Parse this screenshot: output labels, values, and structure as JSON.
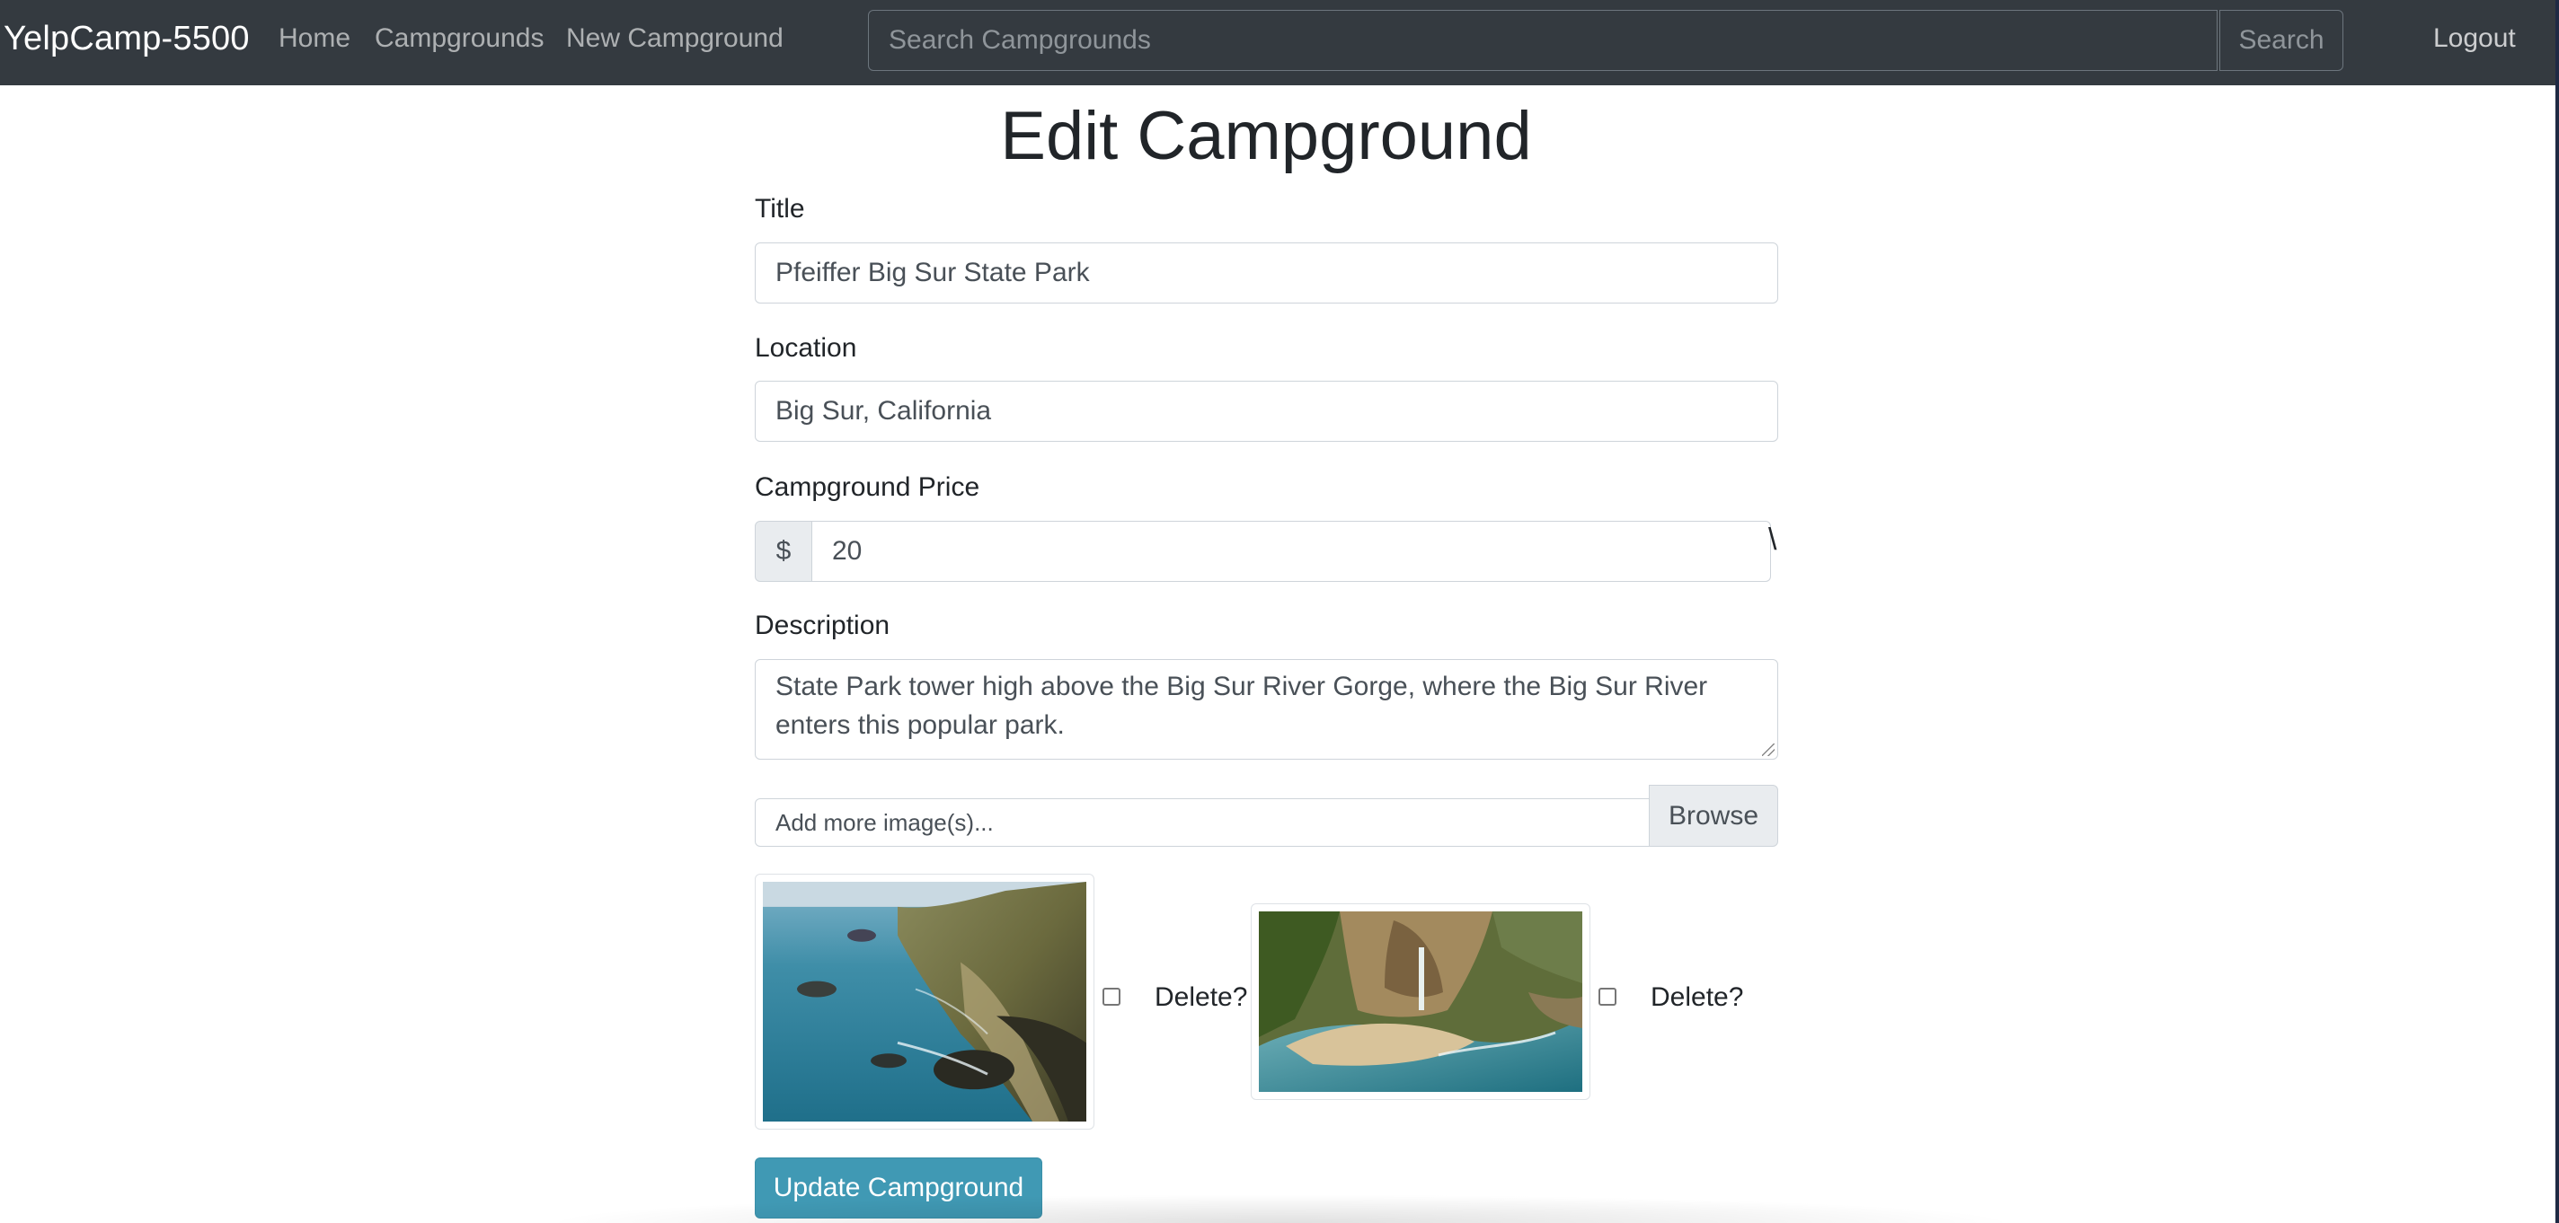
{
  "navbar": {
    "brand": "YelpCamp-5500",
    "links": [
      {
        "label": "Home"
      },
      {
        "label": "Campgrounds"
      },
      {
        "label": "New Campground"
      }
    ],
    "search_placeholder": "Search Campgrounds",
    "search_button": "Search",
    "logout": "Logout"
  },
  "form": {
    "title": "Edit Campground",
    "title_label": "Title",
    "title_value": "Pfeiffer Big Sur State Park",
    "location_label": "Location",
    "location_value": "Big Sur, California",
    "price_label": "Campground Price",
    "price_prefix": "$",
    "price_value": "20",
    "stray_mark": "\\",
    "description_label": "Description",
    "description_visible": "State Park tower high above the Big Sur River Gorge, where the Big Sur River enters this popular park.",
    "file_placeholder": "Add more image(s)...",
    "browse_label": "Browse",
    "images": [
      {
        "icon": "coastline-photo",
        "delete_label": "Delete?",
        "checked": false
      },
      {
        "icon": "waterfall-beach-photo",
        "delete_label": "Delete?",
        "checked": false
      }
    ],
    "submit_label": "Update Campground"
  },
  "colors": {
    "navbar_bg": "#343a40",
    "submit_bg": "#4099b4"
  }
}
